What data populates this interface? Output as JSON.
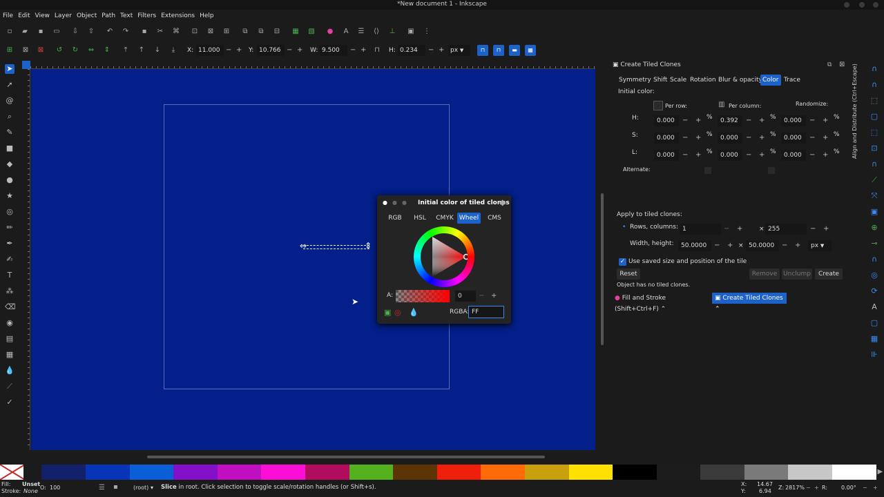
{
  "window": {
    "title": "*New document 1 - Inkscape"
  },
  "menu": [
    "File",
    "Edit",
    "View",
    "Layer",
    "Object",
    "Path",
    "Text",
    "Filters",
    "Extensions",
    "Help"
  ],
  "controls": {
    "x_label": "X:",
    "x_value": "11.000",
    "y_label": "Y:",
    "y_value": "10.766",
    "w_label": "W:",
    "w_value": "9.500",
    "h_label": "H:",
    "h_value": "0.234",
    "unit": "px"
  },
  "panel": {
    "title": "Create Tiled Clones",
    "tabs": [
      "Symmetry",
      "Shift",
      "Scale",
      "Rotation",
      "Blur & opacity",
      "Color",
      "Trace"
    ],
    "active_tab": "Color",
    "initial_color_label": "Initial color:",
    "per_row_label": "Per row:",
    "per_column_label": "Per column:",
    "randomize_label": "Randomize:",
    "rows": [
      {
        "label": "H:",
        "row": "0.000",
        "column": "0.392",
        "random": "0.000"
      },
      {
        "label": "S:",
        "row": "0.000",
        "column": "0.000",
        "random": "0.000"
      },
      {
        "label": "L:",
        "row": "0.000",
        "column": "0.000",
        "random": "0.000"
      }
    ],
    "percent": "%",
    "alternate_label": "Alternate:",
    "apply_label": "Apply to tiled clones:",
    "rows_columns_label": "Rows, columns:",
    "rows_value": "1",
    "times": "×",
    "columns_value": "255",
    "width_height_label": "Width, height:",
    "width_value": "50.0000",
    "height_value": "50.0000",
    "wh_unit": "px",
    "use_saved_label": "Use saved size and position of the tile",
    "reset_label": "Reset",
    "remove_label": "Remove",
    "unclump_label": "Unclump",
    "create_label": "Create",
    "status": "Object has no tiled clones.",
    "dock_tab_fill": "Fill and Stroke (Shift+Ctrl+F)",
    "dock_tab_tiled": "Create Tiled Clones",
    "side_tab": "Align and Distribute (Ctrl+Escape)"
  },
  "color_popup": {
    "title": "Initial color of tiled clones",
    "tabs": [
      "RGB",
      "HSL",
      "CMYK",
      "Wheel",
      "CMS"
    ],
    "active": "Wheel",
    "alpha_label": "A:",
    "alpha_value": "0",
    "rgba_label": "RGBA:",
    "rgba_value": "FF"
  },
  "palette": [
    "#13216b",
    "#0835b8",
    "#0b5fd6",
    "#8410c9",
    "#c00fc0",
    "#fb0fd7",
    "#b10c5d",
    "#52b11c",
    "#5c3405",
    "#f01f0b",
    "#ff6b06",
    "#c89f0c",
    "#ffe100",
    "#000000",
    "#1c1c1c",
    "#3b3b3b",
    "#7a7a7a",
    "#c7c7c7",
    "#ffffff"
  ],
  "status": {
    "fill_label": "Fill:",
    "fill_value": "Unset",
    "stroke_label": "Stroke:",
    "stroke_value": "None",
    "opacity_label": "O:",
    "opacity_value": "100",
    "layer": "(root)",
    "message_bold": "Slice",
    "message": " in root. Click selection to toggle scale/rotation handles (or Shift+s).",
    "x_label": "X:",
    "x_value": "14.67",
    "y_label": "Y:",
    "y_value": "6.94",
    "zoom_label": "Z:",
    "zoom_value": "2817%",
    "rot_label": "R:",
    "rot_value": "0.00°"
  }
}
